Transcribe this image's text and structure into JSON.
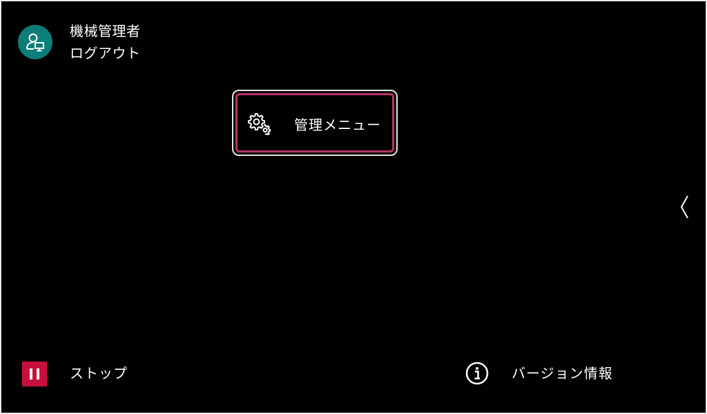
{
  "header": {
    "user_name": "機械管理者",
    "logout_label": "ログアウト",
    "avatar_icon": "user-monitor-icon",
    "avatar_color": "#0c7d78"
  },
  "main": {
    "admin_menu": {
      "label": "管理メニュー",
      "icon": "gears-icon",
      "focus_color": "#b8336a"
    }
  },
  "side": {
    "chevron_icon": "chevron-left-icon"
  },
  "footer": {
    "stop": {
      "label": "ストップ",
      "icon": "pause-icon",
      "color": "#c8103d"
    },
    "version": {
      "label": "バージョン情報",
      "icon": "info-icon"
    }
  }
}
